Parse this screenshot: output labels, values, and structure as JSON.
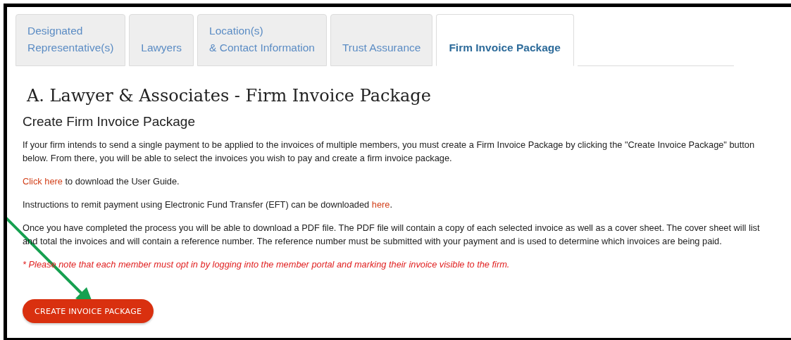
{
  "tabs": [
    {
      "lines": [
        "Designated",
        "Representative(s)"
      ],
      "selected": false
    },
    {
      "lines": [
        "Lawyers"
      ],
      "selected": false
    },
    {
      "lines": [
        "Location(s)",
        "& Contact Information"
      ],
      "selected": false
    },
    {
      "lines": [
        "Trust Assurance"
      ],
      "selected": false
    },
    {
      "lines": [
        "Firm Invoice Package"
      ],
      "selected": true
    }
  ],
  "heading": "A. Lawyer & Associates - Firm Invoice Package",
  "subheading": "Create Firm Invoice Package",
  "paragraphs": [
    {
      "kind": "plain",
      "segments": [
        {
          "kind": "text",
          "text": "If your firm intends to send a single payment to be applied to the invoices of multiple members, you must create a Firm Invoice Package by clicking the \"Create Invoice Package\" button below. From there, you will be able to select the invoices you wish to pay and create a firm invoice package."
        }
      ]
    },
    {
      "kind": "plain",
      "segments": [
        {
          "kind": "link",
          "text": "Click here"
        },
        {
          "kind": "text",
          "text": " to download the User Guide."
        }
      ]
    },
    {
      "kind": "plain",
      "segments": [
        {
          "kind": "text",
          "text": "Instructions to remit payment using Electronic Fund Transfer (EFT) can be downloaded "
        },
        {
          "kind": "link",
          "text": "here"
        },
        {
          "kind": "text",
          "text": "."
        }
      ]
    },
    {
      "kind": "plain",
      "segments": [
        {
          "kind": "text",
          "text": "Once you have completed the process you will be able to download a PDF file. The PDF file will contain a copy of each selected invoice as well as a cover sheet. The cover sheet will list and total the invoices and will contain a reference number. The reference number must be submitted with your payment and is used to determine which invoices are being paid."
        }
      ]
    },
    {
      "kind": "note",
      "segments": [
        {
          "kind": "text",
          "text": "* Please note that each member must opt in by logging into the member portal and marking their invoice visible to the firm."
        }
      ]
    }
  ],
  "button": "CREATE INVOICE PACKAGE"
}
